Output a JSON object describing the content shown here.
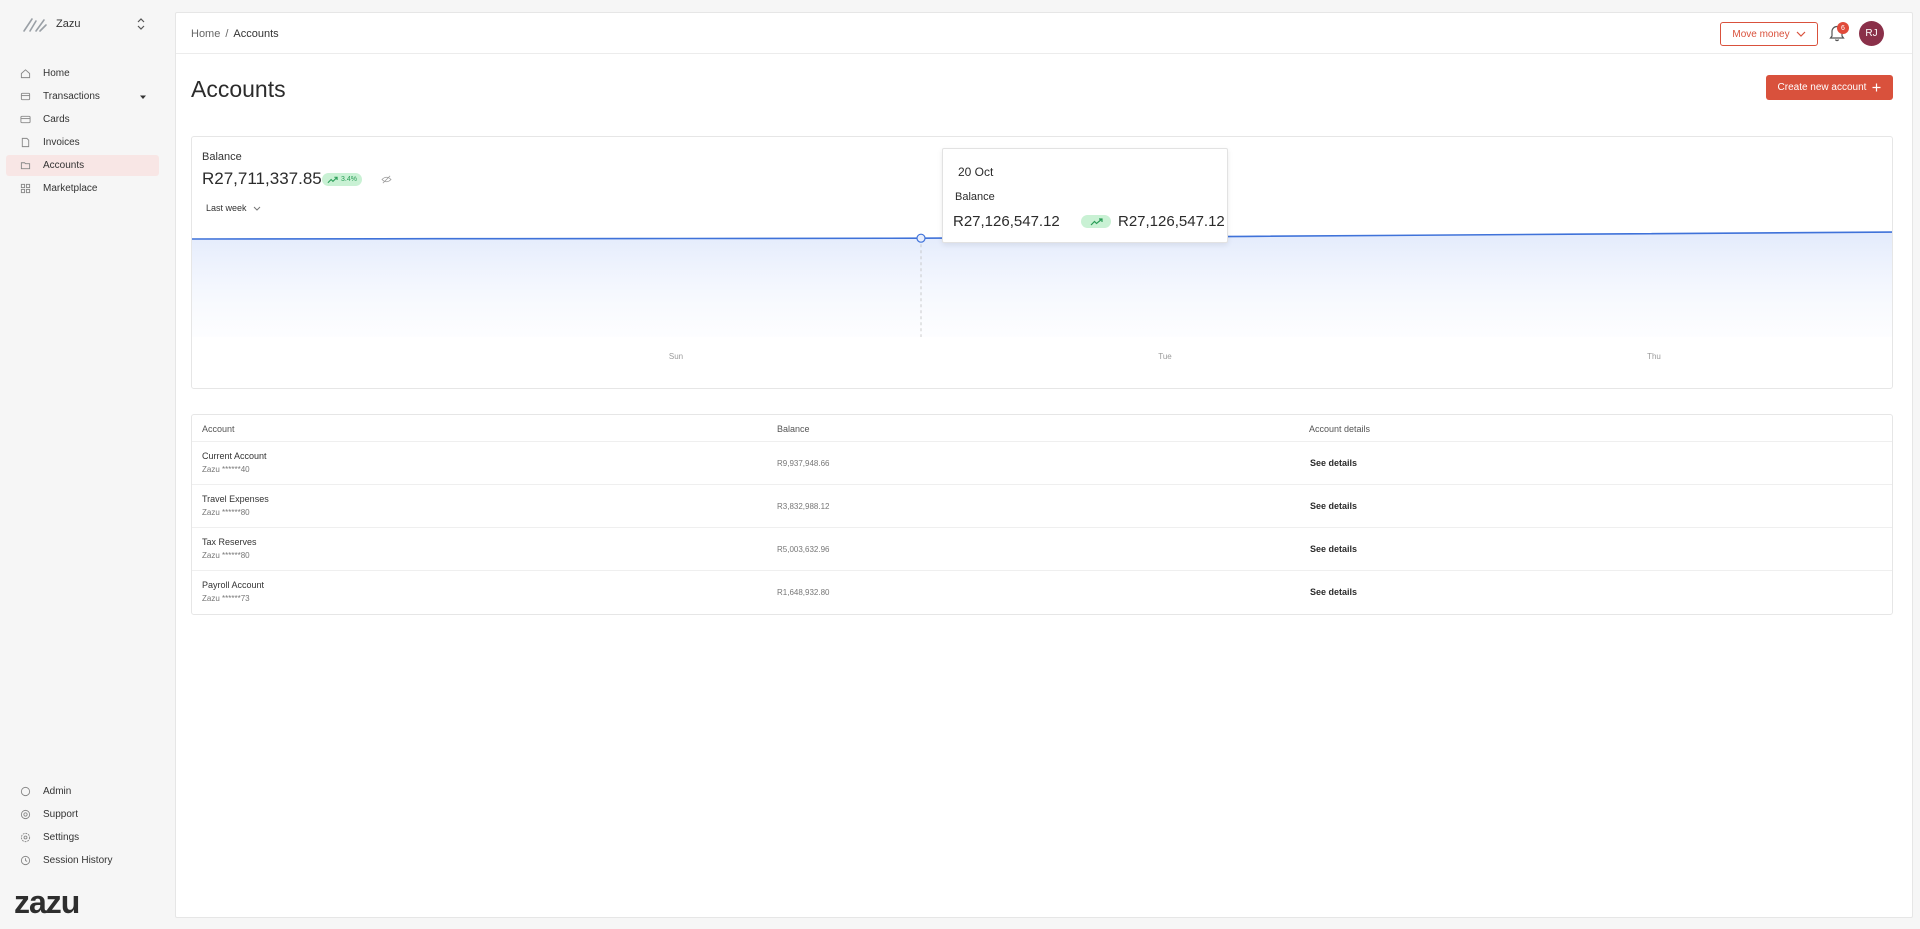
{
  "sidebar": {
    "org_name": "Zazu",
    "items": [
      {
        "label": "Home",
        "icon": "home-icon"
      },
      {
        "label": "Transactions",
        "icon": "transactions-icon"
      },
      {
        "label": "Cards",
        "icon": "card-icon"
      },
      {
        "label": "Invoices",
        "icon": "invoice-icon"
      },
      {
        "label": "Accounts",
        "icon": "accounts-icon",
        "active": true
      },
      {
        "label": "Marketplace",
        "icon": "grid-icon"
      }
    ],
    "bottom_items": [
      {
        "label": "Admin",
        "icon": "admin-icon"
      },
      {
        "label": "Support",
        "icon": "support-icon"
      },
      {
        "label": "Settings",
        "icon": "gear-icon"
      },
      {
        "label": "Session History",
        "icon": "clock-icon"
      }
    ],
    "wordmark": "zazu"
  },
  "header": {
    "breadcrumb": [
      "Home",
      "Accounts"
    ],
    "breadcrumb_sep": "/",
    "move_money_label": "Move money",
    "notification_count": "6",
    "avatar_initials": "RJ"
  },
  "page": {
    "title": "Accounts",
    "create_label": "Create new account"
  },
  "balance": {
    "label": "Balance",
    "value": "R27,711,337.85",
    "change": "3.4%",
    "range": "Last week"
  },
  "tooltip": {
    "date": "20 Oct",
    "label": "Balance",
    "value": "R27,126,547.12",
    "value2": "R27,126,547.12"
  },
  "chart_data": {
    "type": "area",
    "x_ticks": [
      "Sun",
      "Tue",
      "Thu"
    ],
    "series": [
      {
        "values": [
          27050000,
          27080000,
          27100000,
          27126547.12,
          27300000,
          27500000,
          27711337.85
        ]
      }
    ],
    "highlight_index": 3,
    "line_color": "#3f72d9"
  },
  "table": {
    "headers": [
      "Account",
      "Balance",
      "Account details"
    ],
    "rows": [
      {
        "name": "Current Account",
        "number": "Zazu ******40",
        "balance": "R9,937,948.66",
        "action": "See details"
      },
      {
        "name": "Travel Expenses",
        "number": "Zazu ******80",
        "balance": "R3,832,988.12",
        "action": "See details"
      },
      {
        "name": "Tax Reserves",
        "number": "Zazu ******80",
        "balance": "R5,003,632.96",
        "action": "See details"
      },
      {
        "name": "Payroll Account",
        "number": "Zazu ******73",
        "balance": "R1,648,932.80",
        "action": "See details"
      }
    ]
  },
  "colors": {
    "accent": "#d9513c",
    "positive": "#2a9d57",
    "avatar": "#8a3049"
  }
}
